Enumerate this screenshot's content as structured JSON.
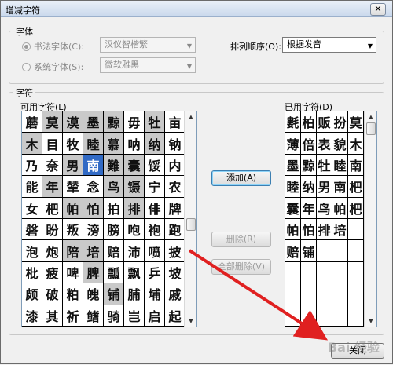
{
  "window": {
    "title": "增减字符",
    "close_glyph": "✕"
  },
  "font_group": {
    "label": "字体",
    "calligraphy_radio": "书法字体(C):",
    "system_radio": "系统字体(S):",
    "calligraphy_value": "汉仪智楷繁",
    "system_value": "微软雅黑",
    "sort_label": "排列顺序(O):",
    "sort_value": "根据发音"
  },
  "chars_group": {
    "label": "字符"
  },
  "available": {
    "label": "可用字符(L)",
    "rows": [
      [
        "蘑",
        "莫",
        "漠",
        "墨",
        "黥",
        "毋",
        "牡",
        "亩"
      ],
      [
        "木",
        "目",
        "牧",
        "睦",
        "慕",
        "呐",
        "纳",
        "钠"
      ],
      [
        "乃",
        "奈",
        "男",
        "南",
        "難",
        "囊",
        "馁",
        "内"
      ],
      [
        "能",
        "年",
        "辇",
        "念",
        "鸟",
        "镊",
        "宁",
        "农"
      ],
      [
        "女",
        "杷",
        "帕",
        "怕",
        "拍",
        "排",
        "俳",
        "牌"
      ],
      [
        "磐",
        "盼",
        "叛",
        "滂",
        "膀",
        "咆",
        "袍",
        "跑"
      ],
      [
        "泡",
        "炮",
        "陪",
        "培",
        "赔",
        "沛",
        "喷",
        "披"
      ],
      [
        "枇",
        "疲",
        "啤",
        "脾",
        "瓢",
        "飘",
        "乒",
        "坡"
      ],
      [
        "颇",
        "破",
        "粕",
        "魄",
        "铺",
        "脯",
        "埔",
        "戚"
      ],
      [
        "漆",
        "其",
        "祈",
        "鳍",
        "骑",
        "岂",
        "启",
        "起"
      ]
    ],
    "used_cells": [
      "0-1",
      "0-2",
      "0-3",
      "0-4",
      "0-6",
      "1-0",
      "1-3",
      "1-4",
      "1-6",
      "2-2",
      "2-4",
      "2-5",
      "3-1",
      "3-4",
      "3-5",
      "4-2",
      "4-3",
      "4-5",
      "6-2",
      "6-3",
      "7-3",
      "8-4"
    ],
    "selected_cell": "2-3"
  },
  "used": {
    "label": "已用字符(D)",
    "rows": [
      [
        "氀",
        "柏",
        "贩",
        "扮",
        "莫"
      ],
      [
        "薄",
        "倍",
        "表",
        "貌",
        "木"
      ],
      [
        "墨",
        "黥",
        "牡",
        "睦",
        "南"
      ],
      [
        "睦",
        "纳",
        "男",
        "南",
        "杷"
      ],
      [
        "囊",
        "年",
        "鸟",
        "帕",
        "杷"
      ],
      [
        "帕",
        "怕",
        "排",
        "培",
        ""
      ],
      [
        "赔",
        "铺",
        "",
        "",
        ""
      ],
      [
        "",
        "",
        "",
        "",
        ""
      ],
      [
        "",
        "",
        "",
        "",
        ""
      ],
      [
        "",
        "",
        "",
        "",
        ""
      ]
    ]
  },
  "buttons": {
    "add": "添加(A)",
    "delete": "删除(R)",
    "delete_all": "全部删除(V)",
    "close": "关闭"
  },
  "watermark": "Bai 经验",
  "colors": {
    "selection": "#316ac5",
    "used_cell": "#c9c9c9",
    "arrow": "#e02020"
  }
}
